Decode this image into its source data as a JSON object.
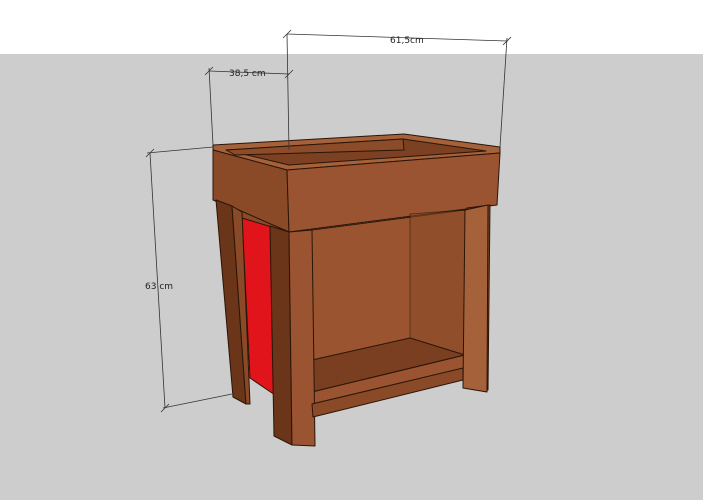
{
  "dimensions": {
    "width_label": "61,5cm",
    "depth_label": "38,5 cm",
    "height_label": "63 cm"
  },
  "colors": {
    "sky": "#ffffff",
    "ground": "#cdcdcd",
    "wood_light": "#a5623a",
    "wood_mid": "#8a4a28",
    "wood_dark": "#6a3519",
    "inner_back": "#9a5530",
    "accent_panel": "#e0141a",
    "edge": "#2a1508",
    "dim_line": "#333333"
  }
}
